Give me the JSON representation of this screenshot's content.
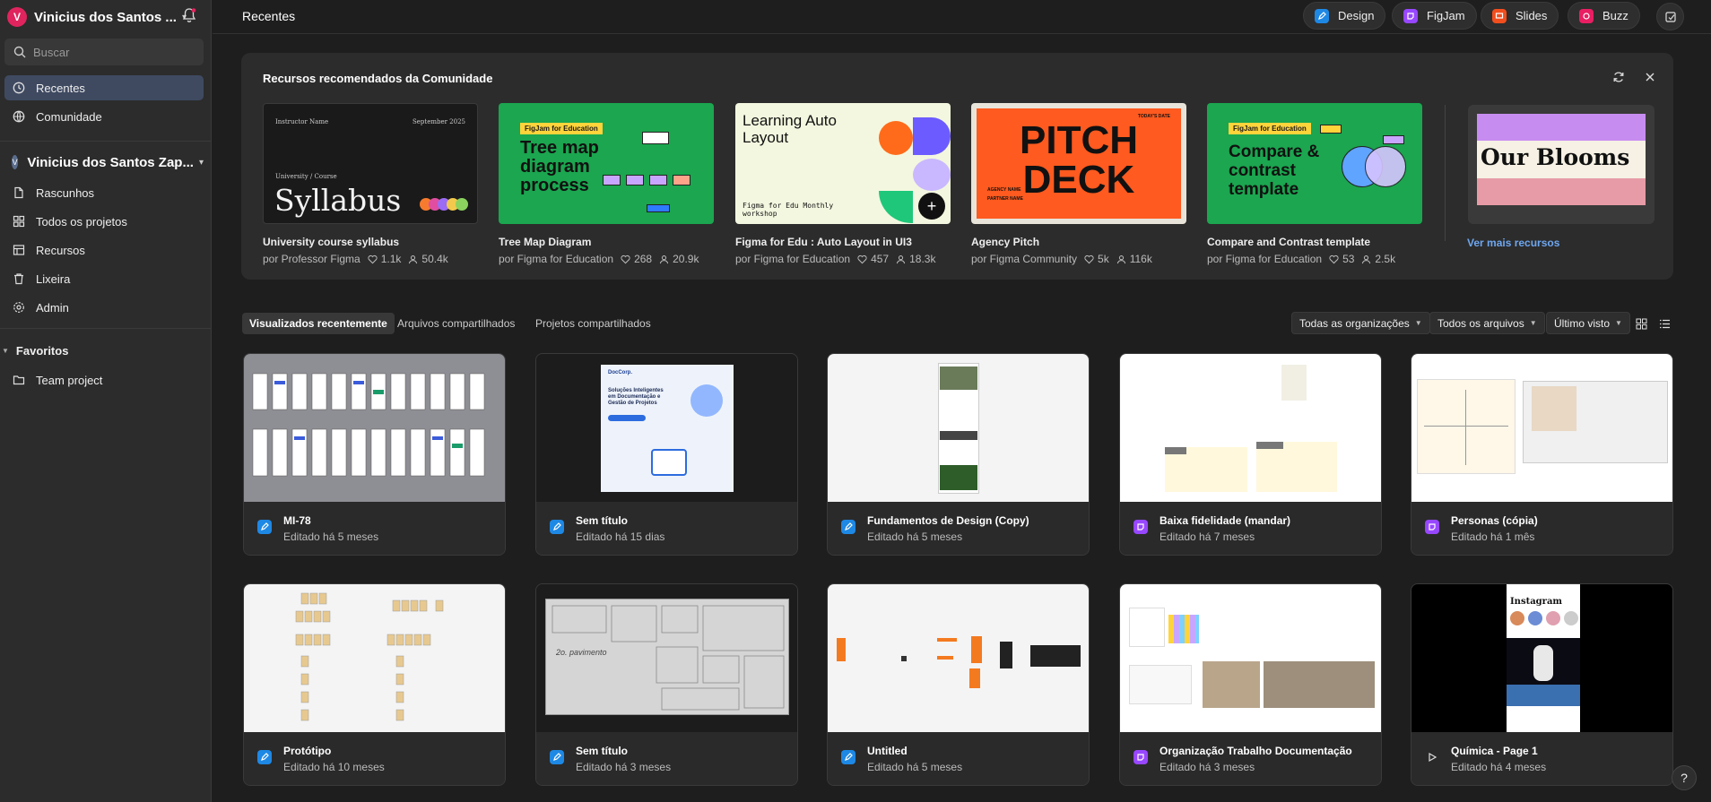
{
  "sidebar": {
    "user_initial": "V",
    "user_name": "Vinicius dos Santos ...",
    "search_placeholder": "Buscar",
    "items": [
      {
        "label": "Recentes",
        "icon": "clock-icon",
        "active": true
      },
      {
        "label": "Comunidade",
        "icon": "globe-icon",
        "active": false
      }
    ],
    "team_initial": "V",
    "team_name": "Vinicius dos Santos Zap...",
    "team_items": [
      {
        "label": "Rascunhos",
        "icon": "file-icon"
      },
      {
        "label": "Todos os projetos",
        "icon": "grid-icon"
      },
      {
        "label": "Recursos",
        "icon": "resources-icon"
      },
      {
        "label": "Lixeira",
        "icon": "trash-icon"
      },
      {
        "label": "Admin",
        "icon": "gear-icon"
      }
    ],
    "favorites_label": "Favoritos",
    "favorites": [
      {
        "label": "Team project",
        "icon": "folder-icon"
      }
    ]
  },
  "topbar": {
    "title": "Recentes",
    "apps": [
      {
        "label": "Design",
        "color": "#1e88e5"
      },
      {
        "label": "FigJam",
        "color": "#9747ff"
      },
      {
        "label": "Slides",
        "color": "#f24e1e"
      },
      {
        "label": "Buzz",
        "color": "#e91e63"
      }
    ]
  },
  "resources": {
    "title": "Recursos recomendados da Comunidade",
    "cards": [
      {
        "name": "University course syllabus",
        "author": "por Professor Figma",
        "likes": "1.1k",
        "users": "50.4k",
        "thumb": {
          "top_left": "Instructor Name",
          "top_right": "September 2025",
          "sub": "University / Course",
          "big": "Syllabus"
        }
      },
      {
        "name": "Tree Map Diagram",
        "author": "por Figma for Education",
        "likes": "268",
        "users": "20.9k",
        "thumb": {
          "tag": "FigJam for Education",
          "big": "Tree map diagram process"
        }
      },
      {
        "name": "Figma for Edu : Auto Layout in UI3",
        "author": "por Figma for Education",
        "likes": "457",
        "users": "18.3k",
        "thumb": {
          "big": "Learning Auto Layout",
          "small": "Figma for Edu Monthly workshop"
        }
      },
      {
        "name": "Agency Pitch",
        "author": "por Figma Community",
        "likes": "5k",
        "users": "116k",
        "thumb": {
          "big": "PITCH DECK",
          "corner": "TODAY'S DATE",
          "l1": "AGENCY NAME",
          "l2": "PARTNER NAME"
        }
      },
      {
        "name": "Compare and Contrast template",
        "author": "por Figma for Education",
        "likes": "53",
        "users": "2.5k",
        "thumb": {
          "tag": "FigJam for Education",
          "big": "Compare & contrast template"
        }
      }
    ],
    "more_thumb_text": "Our Blooms",
    "more_link": "Ver mais recursos"
  },
  "tabs": [
    "Visualizados recentemente",
    "Arquivos compartilhados",
    "Projetos compartilhados"
  ],
  "filters": {
    "org": "Todas as organizações",
    "files": "Todos os arquivos",
    "sort": "Último visto"
  },
  "files": [
    {
      "name": "MI-78",
      "date": "Editado há 5 meses",
      "type": "design"
    },
    {
      "name": "Sem título",
      "date": "Editado há 15 dias",
      "type": "design",
      "thumb_brand": "DocCorp.",
      "thumb_text": "Soluções Inteligentes em Documentação e Gestão de Projetos"
    },
    {
      "name": "Fundamentos de Design (Copy)",
      "date": "Editado há 5 meses",
      "type": "design"
    },
    {
      "name": "Baixa fidelidade (mandar)",
      "date": "Editado há 7 meses",
      "type": "figjam"
    },
    {
      "name": "Personas (cópia)",
      "date": "Editado há 1 mês",
      "type": "figjam"
    },
    {
      "name": "Protótipo",
      "date": "Editado há 10 meses",
      "type": "design"
    },
    {
      "name": "Sem título",
      "date": "Editado há 3 meses",
      "type": "design",
      "thumb_text": "2o. pavimento"
    },
    {
      "name": "Untitled",
      "date": "Editado há 5 meses",
      "type": "design"
    },
    {
      "name": "Organização Trabalho Documentação",
      "date": "Editado há 3 meses",
      "type": "figjam"
    },
    {
      "name": "Química - Page 1",
      "date": "Editado há 4 meses",
      "type": "slides-play",
      "thumb_text": "Instagram"
    }
  ],
  "help_label": "?"
}
